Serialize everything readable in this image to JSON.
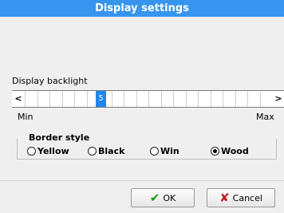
{
  "window": {
    "title": "Display settings"
  },
  "backlight": {
    "label": "Display backlight",
    "left_arrow": "<",
    "right_arrow": ">",
    "value": "5",
    "min_label": "Min",
    "max_label": "Max",
    "level_fraction": 0.25
  },
  "border_style": {
    "title": "Border style",
    "options": [
      {
        "label": "Yellow",
        "checked": false
      },
      {
        "label": "Black",
        "checked": false
      },
      {
        "label": "Win",
        "checked": false
      },
      {
        "label": "Wood",
        "checked": true
      }
    ]
  },
  "buttons": {
    "ok_label": "OK",
    "cancel_label": "Cancel",
    "ok_icon": "checkmark-icon",
    "cancel_icon": "x-mark-icon"
  },
  "colors": {
    "titlebar": "#3795ef",
    "slider_thumb": "#1f86ef",
    "ok_icon": "#1a9b1a",
    "cancel_icon": "#c21b1b"
  }
}
